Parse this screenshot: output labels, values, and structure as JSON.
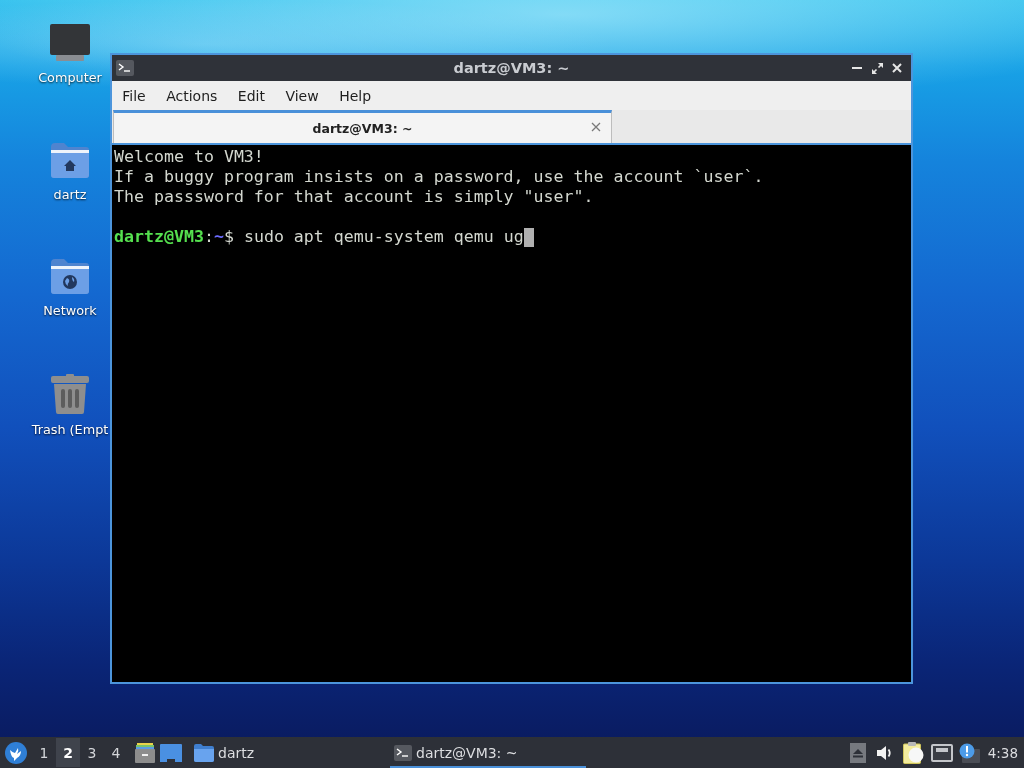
{
  "desktop_icons": [
    {
      "kind": "computer",
      "label": "Computer"
    },
    {
      "kind": "home",
      "label": "dartz"
    },
    {
      "kind": "network",
      "label": "Network"
    },
    {
      "kind": "trash",
      "label": "Trash (Empt"
    }
  ],
  "window": {
    "title": "dartz@VM3: ~",
    "menu": [
      "File",
      "Actions",
      "Edit",
      "View",
      "Help"
    ],
    "tabs": [
      {
        "label": "dartz@VM3: ~",
        "selected": true
      }
    ]
  },
  "terminal": {
    "lines": [
      "Welcome to VM3!",
      "If a buggy program insists on a password, use the account `user`.",
      "The passsword for that account is simply \"user\"."
    ],
    "prompt": {
      "user_host": "dartz@VM3",
      "separator": ":",
      "path": "~",
      "symbol": "$"
    },
    "command": "sudo apt qemu-system qemu ug"
  },
  "taskbar": {
    "workspaces": [
      {
        "label": "1",
        "selected": false
      },
      {
        "label": "2",
        "selected": true
      },
      {
        "label": "3",
        "selected": false
      },
      {
        "label": "4",
        "selected": false
      }
    ],
    "launchers": [
      {
        "kind": "file-cabinet"
      },
      {
        "kind": "desktop"
      }
    ],
    "tasks": [
      {
        "kind": "folder",
        "label": "dartz",
        "selected": false
      },
      {
        "kind": "terminal",
        "label": "dartz@VM3: ~",
        "selected": true
      }
    ],
    "tray": [
      {
        "kind": "eject"
      },
      {
        "kind": "volume"
      },
      {
        "kind": "clipboard"
      },
      {
        "kind": "network"
      },
      {
        "kind": "notification"
      }
    ],
    "clock": "4:38"
  }
}
